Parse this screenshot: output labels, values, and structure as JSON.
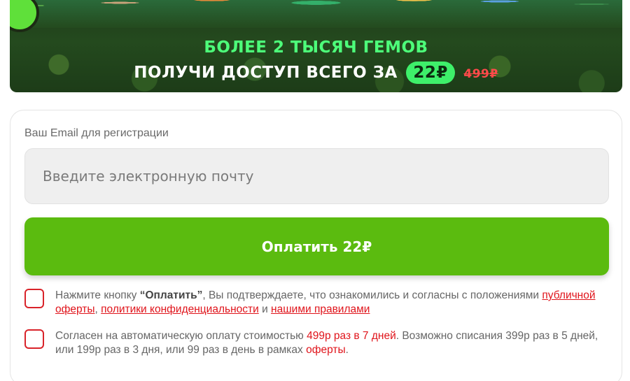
{
  "banner": {
    "line1": "БОЛЕЕ 2 ТЫСЯЧ ГЕМОВ",
    "line2_prefix": "ПОЛУЧИ ДОСТУП ВСЕГО ЗА",
    "price_new": "22₽",
    "price_old": "499₽",
    "accent_color": "#4dff7a",
    "old_price_color": "#ff4a4a"
  },
  "form": {
    "email_label": "Ваш Email для регистрации",
    "email_placeholder": "Введите электронную почту",
    "email_value": "",
    "pay_button_label": "Оплатить 22₽",
    "button_color": "#5bbb0f"
  },
  "consent1": {
    "checked": false,
    "text_prefix": "Нажмите кнопку ",
    "text_bold": "“Оплатить”",
    "text_middle": ", Вы подтверждаете, что ознакомились и согласны с положениями ",
    "link_offer": "публичной оферты",
    "sep1": ", ",
    "link_privacy": "политики конфиденциальности",
    "sep2": " и ",
    "link_rules": "нашими правилами"
  },
  "consent2": {
    "checked": false,
    "text_prefix": "Согласен на автоматическую оплату стоимостью ",
    "text_highlight": "499р раз в 7 дней",
    "text_middle": ". Возможно списания 399р раз в 5 дней, или 199р раз в 3 дня, или 99 раз в день в рамках ",
    "link_offer": "оферты",
    "text_end": "."
  },
  "icons": {
    "brand_logo": "logo-badge-icon"
  }
}
